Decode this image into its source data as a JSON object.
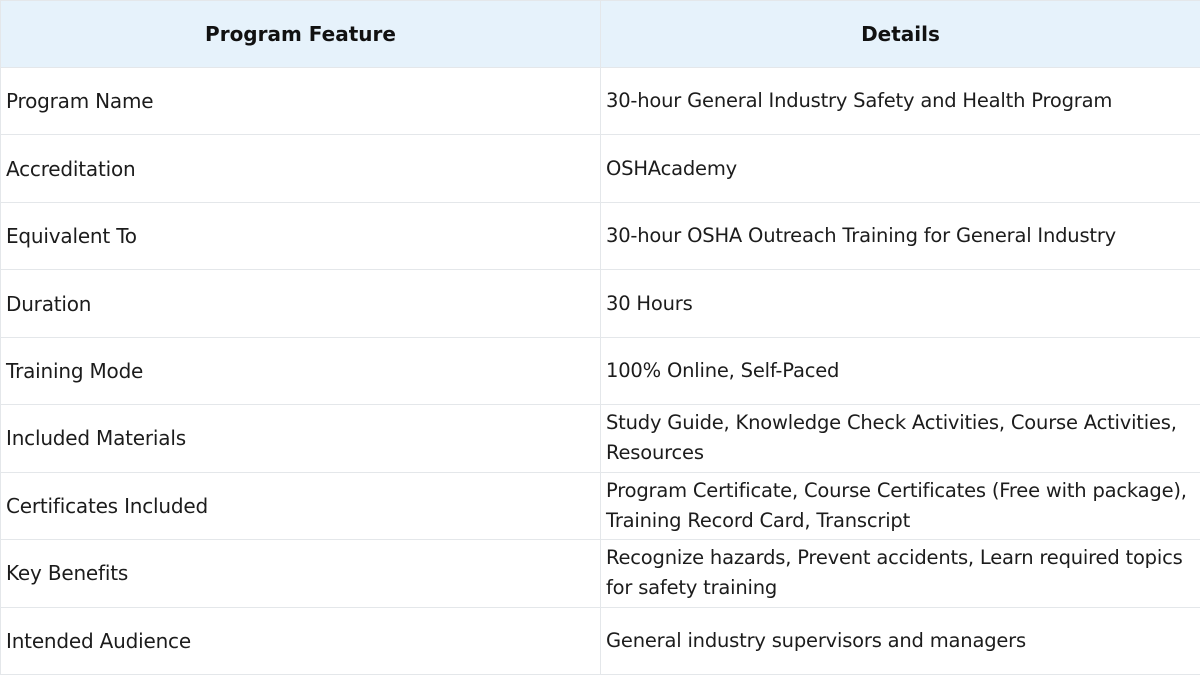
{
  "table": {
    "headers": [
      "Program Feature",
      "Details"
    ],
    "rows": [
      [
        "Program Name",
        "30-hour General Industry Safety and Health Program"
      ],
      [
        "Accreditation",
        "OSHAcademy"
      ],
      [
        "Equivalent To",
        "30-hour OSHA Outreach Training for General Industry"
      ],
      [
        "Duration",
        "30 Hours"
      ],
      [
        "Training Mode",
        "100% Online, Self-Paced"
      ],
      [
        "Included Materials",
        "Study Guide, Knowledge Check Activities, Course Activities, Resources"
      ],
      [
        "Certificates Included",
        "Program Certificate, Course Certificates (Free with package), Training Record Card, Transcript"
      ],
      [
        "Key Benefits",
        "Recognize hazards, Prevent accidents, Learn required topics for safety training"
      ],
      [
        "Intended Audience",
        "General industry supervisors and managers"
      ]
    ]
  },
  "colors": {
    "header_background": "#e6f2fb",
    "border": "#e4e7ea",
    "text": "#1c1c1c"
  }
}
